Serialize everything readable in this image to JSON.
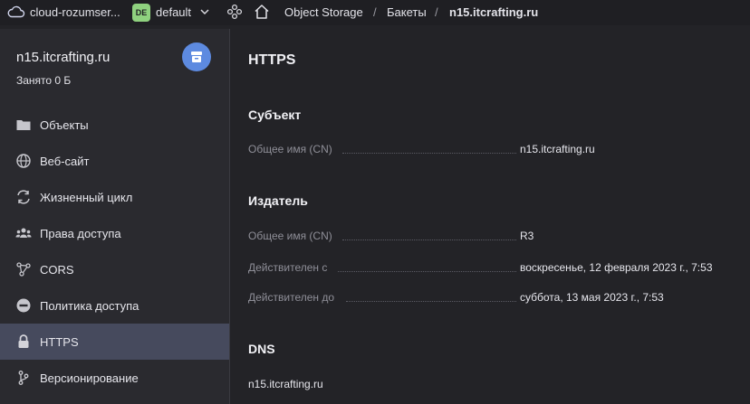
{
  "topbar": {
    "cloud_label": "cloud-rozumser...",
    "folder_badge": "DE",
    "folder_label": "default",
    "breadcrumbs": [
      "Object Storage",
      "Бакеты",
      "n15.itcrafting.ru"
    ],
    "separator": "/"
  },
  "sidebar": {
    "bucket_name": "n15.itcrafting.ru",
    "usage": "Занято 0 Б",
    "items": [
      {
        "label": "Объекты",
        "icon": "folder-icon"
      },
      {
        "label": "Веб-сайт",
        "icon": "globe-icon"
      },
      {
        "label": "Жизненный цикл",
        "icon": "lifecycle-icon"
      },
      {
        "label": "Права доступа",
        "icon": "users-icon"
      },
      {
        "label": "CORS",
        "icon": "cors-icon"
      },
      {
        "label": "Политика доступа",
        "icon": "policy-icon"
      },
      {
        "label": "HTTPS",
        "icon": "lock-icon"
      },
      {
        "label": "Версионирование",
        "icon": "versioning-icon"
      }
    ],
    "active_index": 6
  },
  "main": {
    "title": "HTTPS",
    "subject": {
      "heading": "Субъект",
      "rows": [
        {
          "label": "Общее имя (CN)",
          "value": "n15.itcrafting.ru"
        }
      ]
    },
    "issuer": {
      "heading": "Издатель",
      "rows": [
        {
          "label": "Общее имя (CN)",
          "value": "R3"
        },
        {
          "label": "Действителен с",
          "value": "воскресенье, 12 февраля 2023 г., 7:53"
        },
        {
          "label": "Действителен до",
          "value": "суббота, 13 мая 2023 г., 7:53"
        }
      ]
    },
    "dns": {
      "heading": "DNS",
      "value": "n15.itcrafting.ru"
    }
  },
  "colors": {
    "accent": "#5d8ae0",
    "badge": "#8fd17f",
    "active_item": "#464a5d"
  }
}
